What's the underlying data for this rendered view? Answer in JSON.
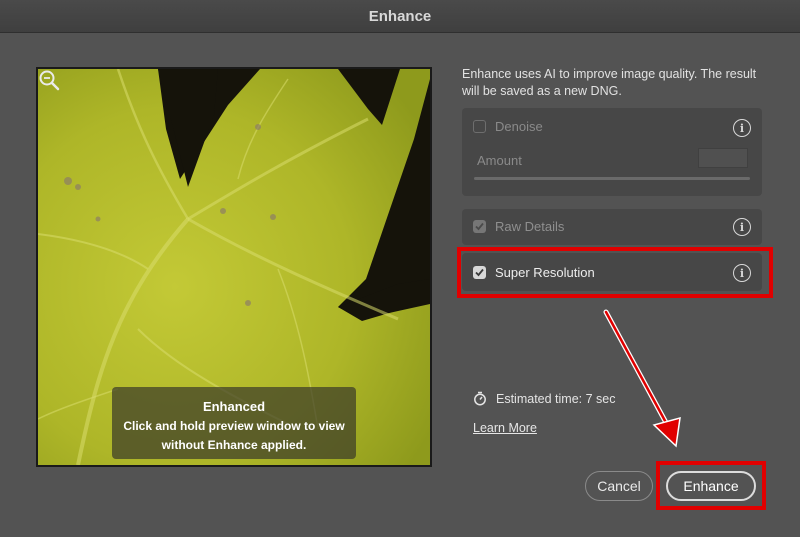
{
  "dialog": {
    "title": "Enhance"
  },
  "preview": {
    "overlay_title": "Enhanced",
    "overlay_line1": "Click and hold preview window to view",
    "overlay_line2": "without Enhance applied.",
    "zoom_icon": "magnifier-icon"
  },
  "intro_text": "Enhance uses AI to improve image quality. The result will be saved as a new DNG.",
  "options": {
    "denoise": {
      "label": "Denoise",
      "checked": false,
      "enabled": false
    },
    "amount": {
      "label": "Amount"
    },
    "raw_details": {
      "label": "Raw Details",
      "checked": true,
      "enabled": false
    },
    "super_resolution": {
      "label": "Super Resolution",
      "checked": true,
      "enabled": true
    }
  },
  "estimate": {
    "text": "Estimated time: 7 sec",
    "icon": "stopwatch-icon"
  },
  "learn_more": "Learn More",
  "buttons": {
    "cancel": "Cancel",
    "enhance": "Enhance"
  },
  "colors": {
    "highlight": "#e00000",
    "background": "#535353",
    "leaf": "#b6bf2c"
  }
}
